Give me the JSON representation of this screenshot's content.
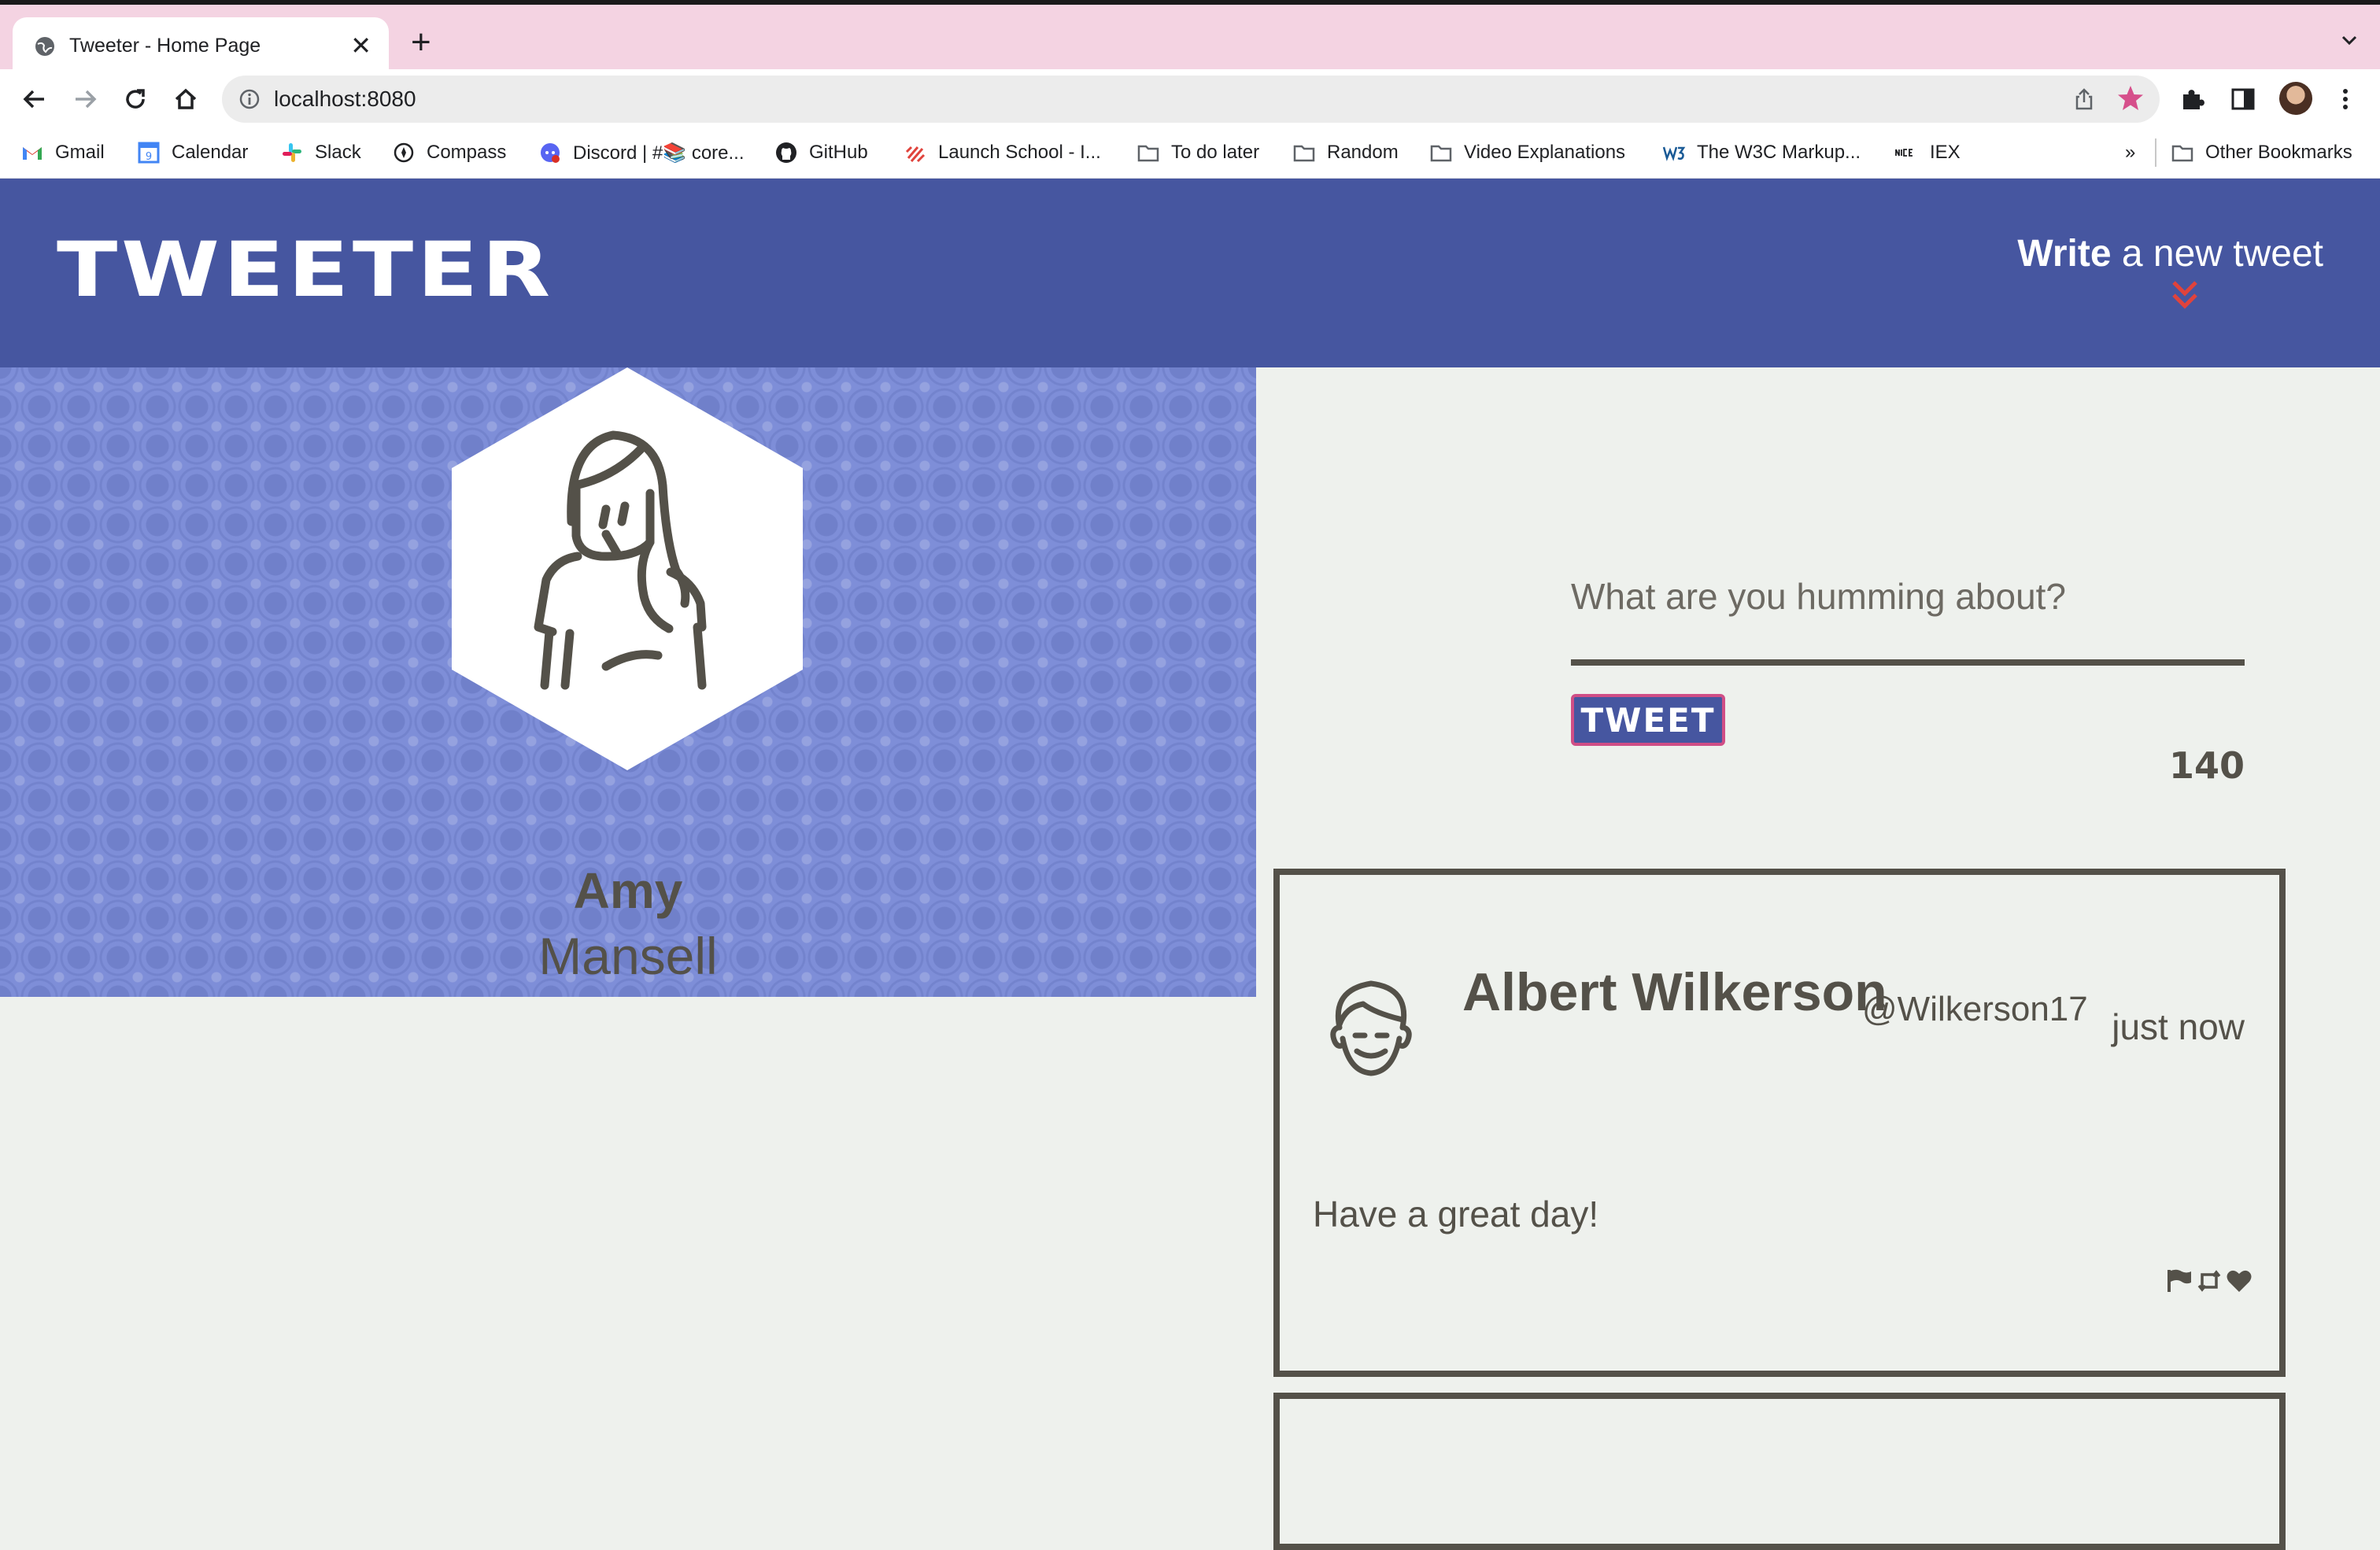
{
  "browser": {
    "tab_title": "Tweeter - Home Page",
    "url": "localhost:8080",
    "bookmarks": [
      {
        "label": "Gmail",
        "icon": "gmail-icon"
      },
      {
        "label": "Calendar",
        "icon": "calendar-icon"
      },
      {
        "label": "Slack",
        "icon": "slack-icon"
      },
      {
        "label": "Compass",
        "icon": "compass-icon"
      },
      {
        "label": "Discord | #📚 core...",
        "icon": "discord-icon"
      },
      {
        "label": "GitHub",
        "icon": "github-icon"
      },
      {
        "label": "Launch School - I...",
        "icon": "launch-school-icon"
      },
      {
        "label": "To do later",
        "icon": "folder-icon"
      },
      {
        "label": "Random",
        "icon": "folder-icon"
      },
      {
        "label": "Video Explanations",
        "icon": "folder-icon"
      },
      {
        "label": "The W3C Markup...",
        "icon": "w3c-icon"
      },
      {
        "label": "IEX",
        "icon": "nice-icon"
      }
    ],
    "overflow_label": "»",
    "other_bookmarks": "Other Bookmarks",
    "colors": {
      "tabstrip": "#f4d3e2",
      "star": "#d64f8b"
    }
  },
  "header": {
    "logo": "TWEETER",
    "write_bold": "Write",
    "write_rest": " a new tweet",
    "colors": {
      "background": "#4656a0",
      "chevron": "#e0433c"
    }
  },
  "profile": {
    "first_name": "Amy",
    "last_name": "Mansell",
    "colors": {
      "background": "#7e8ed8"
    }
  },
  "composer": {
    "placeholder": "What are you humming about?",
    "button_label": "TWEET",
    "char_count": "140"
  },
  "tweets": [
    {
      "name": "Albert Wilkerson",
      "handle": "@Wilkerson17",
      "time": "just now",
      "body": "Have a great day!",
      "actions": [
        "flag-icon",
        "retweet-icon",
        "heart-icon"
      ]
    }
  ],
  "colors": {
    "text": "#545149",
    "page_bg": "#eef1ed",
    "button_border": "#d04e86"
  }
}
